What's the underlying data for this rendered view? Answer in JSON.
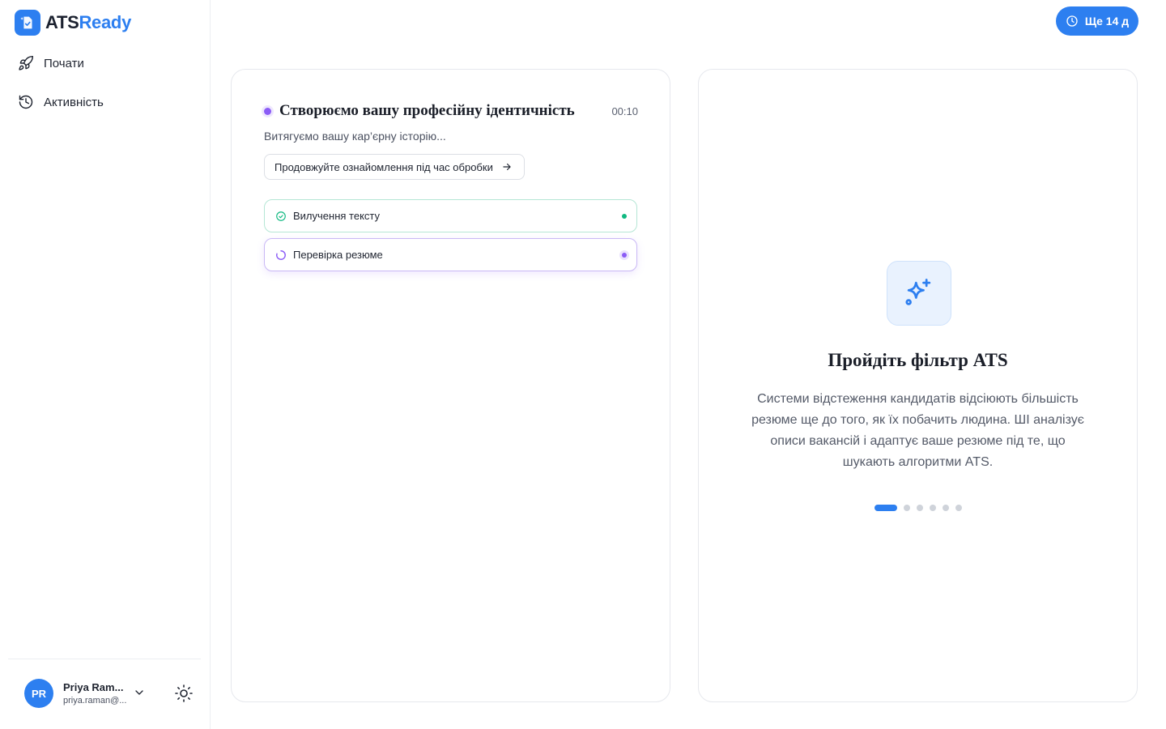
{
  "brand": {
    "name_part1": "ATS",
    "name_part2": "Ready",
    "accent": "#2d7ff0"
  },
  "sidebar": {
    "items": [
      {
        "label": "Почати",
        "icon": "rocket-icon"
      },
      {
        "label": "Активність",
        "icon": "history-icon"
      }
    ]
  },
  "user": {
    "initials": "PR",
    "name": "Priya Ram...",
    "email": "priya.raman@..."
  },
  "trial": {
    "label": "Ще 14 д",
    "icon": "clock-icon"
  },
  "processing": {
    "title": "Створюємо вашу професійну ідентичність",
    "timer": "00:10",
    "subtitle": "Витягуємо вашу кар’єрну історію...",
    "continue_label": "Продовжуйте ознайомлення під час обробки",
    "steps": [
      {
        "label": "Вилучення тексту",
        "status": "done",
        "color": "#10b981"
      },
      {
        "label": "Перевірка резюме",
        "status": "in-progress",
        "color": "#8b5cf6"
      }
    ]
  },
  "feature": {
    "icon": "sparkles-icon",
    "title": "Пройдіть фільтр ATS",
    "description": "Системи відстеження кандидатів відсіюють більшість резюме ще до того, як їх побачить людина. ШІ аналізує описи вакансій і адаптує ваше резюме під те, що шукають алгоритми ATS.",
    "slides_total": 6,
    "active_slide": 1
  }
}
